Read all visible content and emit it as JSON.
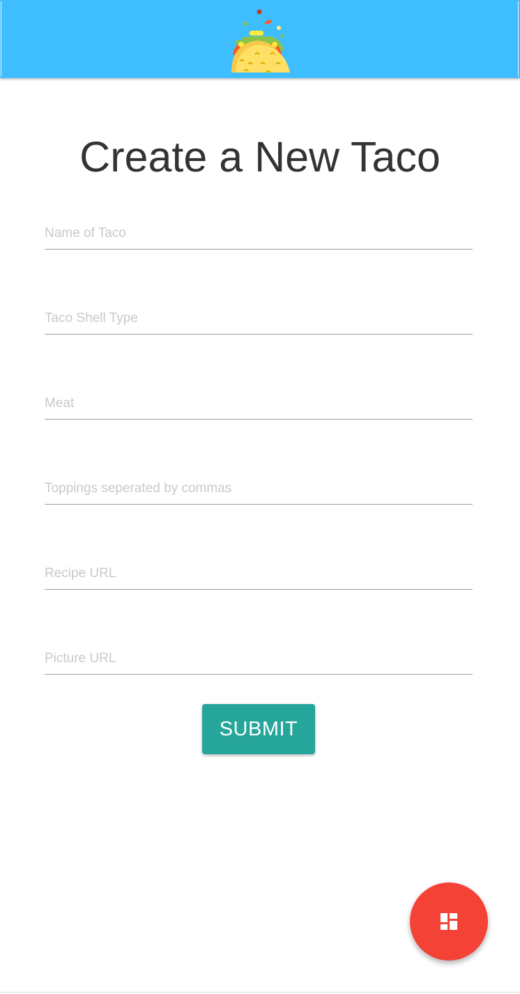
{
  "header": {
    "logo_icon": "taco-icon",
    "bar_color": "#3ebefe"
  },
  "page": {
    "title": "Create a New Taco"
  },
  "form": {
    "fields": [
      {
        "placeholder": "Name of Taco",
        "value": ""
      },
      {
        "placeholder": "Taco Shell Type",
        "value": ""
      },
      {
        "placeholder": "Meat",
        "value": ""
      },
      {
        "placeholder": "Toppings seperated by commas",
        "value": ""
      },
      {
        "placeholder": "Recipe URL",
        "value": ""
      },
      {
        "placeholder": "Picture URL",
        "value": ""
      }
    ],
    "submit_label": "SUBMIT",
    "submit_color": "#26a69a"
  },
  "fab": {
    "icon": "dashboard-icon",
    "color": "#f44336"
  }
}
